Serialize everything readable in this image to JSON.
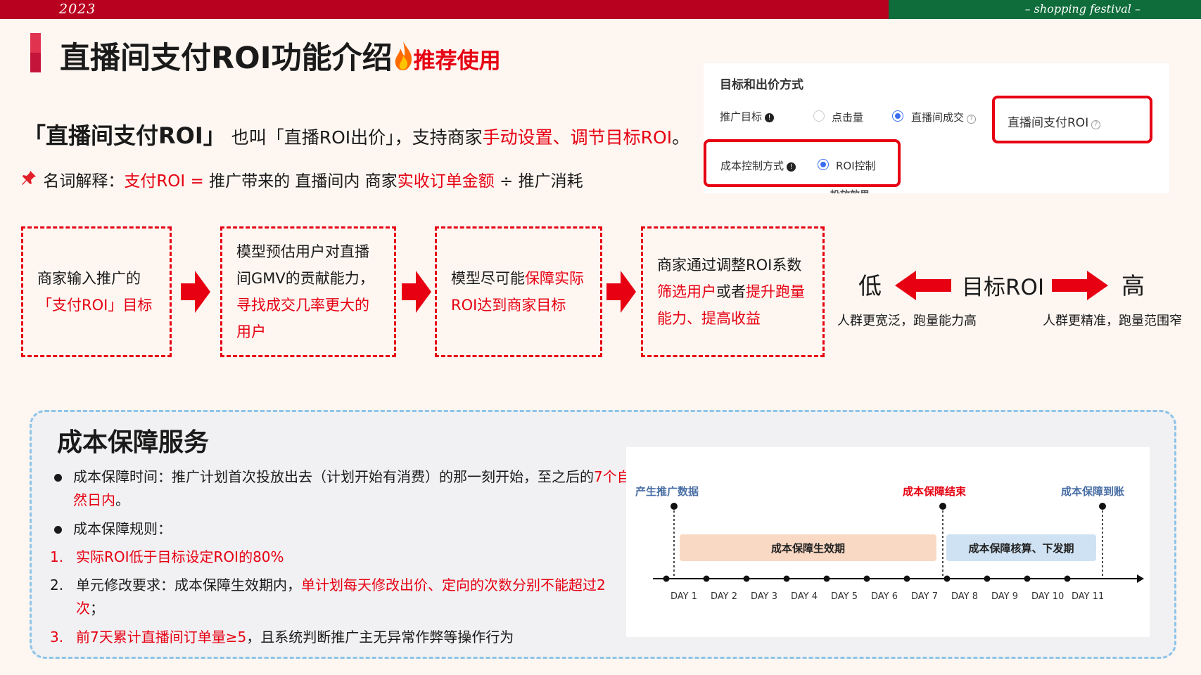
{
  "header": {
    "year": "2023",
    "festival": "– shopping  festival –"
  },
  "title": {
    "main": "直播间支付ROI功能介绍",
    "recommend": "推荐使用"
  },
  "intro": {
    "name": "「直播间支付ROI」",
    "also_called": "也叫「直播ROI出价」，支持商家",
    "highlight": "手动设置、调节目标ROI",
    "end": "。"
  },
  "definition": {
    "label": "名词解释：",
    "formula_lhs": "支付ROI =",
    "part1": " 推广带来的 直播间内 商家",
    "highlight": "实收订单金额",
    "divide": " ÷ ",
    "part2": "推广消耗"
  },
  "panel": {
    "title": "目标和出价方式",
    "goal_label": "推广目标",
    "opt_clicks": "点击量",
    "opt_live_deal": "直播间成交",
    "opt_live_pay_roi": "直播间支付ROI",
    "cost_label": "成本控制方式",
    "opt_roi_control": "ROI控制",
    "cut_text": "投放效果"
  },
  "flow": [
    {
      "plain1": "商家输入推广的",
      "red1": "「支付ROI」目标",
      "plain2": "",
      "red2": ""
    },
    {
      "plain1": "模型预估用户对直播间GMV的贡献能力，",
      "red1": "寻找成交几率更大的用户",
      "plain2": "",
      "red2": ""
    },
    {
      "plain1": "模型尽可能",
      "red1": "保障实际ROI达到商家目标",
      "plain2": "",
      "red2": ""
    },
    {
      "plain1": "商家通过调整ROI系数",
      "red1": "筛选用户",
      "plain2": "或者",
      "red2": "提升跑量能力、提高收益"
    }
  ],
  "roi_scale": {
    "low": "低",
    "high": "高",
    "middle": "目标ROI",
    "low_caption": "人群更宽泛，跑量能力高",
    "high_caption": "人群更精准，跑量范围窄"
  },
  "cost": {
    "title": "成本保障服务",
    "time_label": "成本保障时间：推广计划首次投放出去（计划开始有消费）的那一刻开始，至之后的",
    "time_red": "7个自然日内",
    "time_end": "。",
    "rule_label": "成本保障规则：",
    "rules": [
      {
        "n": "1.",
        "plain": "",
        "red": "实际ROI低于目标设定ROI的80%",
        "tail": ""
      },
      {
        "n": "2.",
        "plain": "单元修改要求：成本保障生效期内，",
        "red": "单计划每天修改出价、定向的次数分别不能超过2次",
        "tail": "；"
      },
      {
        "n": "3.",
        "plain": "",
        "red": "前7天累计直播间订单量≥5",
        "tail": "，且系统判断推广主无异常作弊等操作行为"
      }
    ]
  },
  "timeline": {
    "marker_start": "产生推广数据",
    "marker_end": "成本保障结束",
    "marker_paid": "成本保障到账",
    "bar_effective": "成本保障生效期",
    "bar_settle": "成本保障核算、下发期",
    "days": [
      "DAY 1",
      "DAY 2",
      "DAY 3",
      "DAY 4",
      "DAY 5",
      "DAY 6",
      "DAY 7",
      "DAY 8",
      "DAY 9",
      "DAY 10",
      "DAY 11"
    ],
    "colors": {
      "start": "#4a6fa5",
      "end": "#e60012",
      "bar_effective": "#f9d8c4",
      "bar_settle": "#cfe2f3"
    }
  },
  "colors": {
    "accent_red": "#e60012",
    "top_red": "#b8001f",
    "top_green": "#0f6d3b"
  }
}
